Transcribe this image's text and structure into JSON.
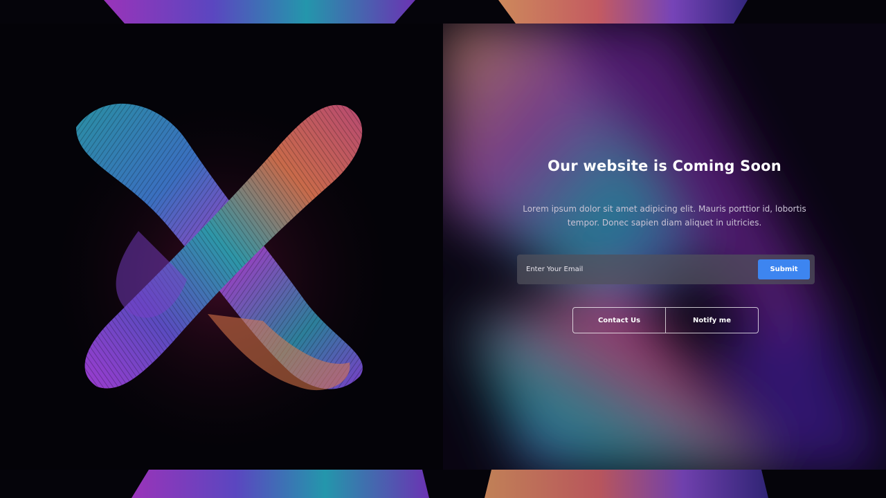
{
  "hero": {
    "heading": "Our website is Coming Soon",
    "description": "Lorem ipsum dolor sit amet adipicing elit. Mauris porttior id, lobortis tempor. Donec sapien diam aliquet in uitricies."
  },
  "subscribe": {
    "placeholder": "Enter Your Email",
    "submit_label": "Submit"
  },
  "actions": {
    "contact_label": "Contact Us",
    "notify_label": "Notify me"
  },
  "colors": {
    "accent": "#3d85f0",
    "background": "#05040a"
  },
  "artwork": {
    "left_image": "abstract-x-ribbon-sculpture"
  }
}
